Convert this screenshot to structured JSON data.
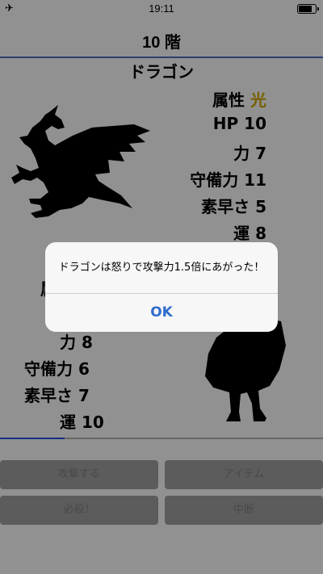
{
  "status": {
    "time": "19:11",
    "airplane_icon": "airplane-icon",
    "battery_level": 0.85
  },
  "header": {
    "floor": "10 階"
  },
  "enemy": {
    "name": "ドラゴン",
    "attribute_label": "属性",
    "attribute_value": "光",
    "attribute_color": "#c9a000",
    "hp": "HP 10",
    "power": "力 7",
    "defense": "守備力 11",
    "speed": "素早さ 5",
    "luck": "運 8",
    "icon": "dragon-icon"
  },
  "player": {
    "partial_label": "属",
    "power": "力 8",
    "defense": "守備力 6",
    "speed": "素早さ 7",
    "luck": "運 10",
    "icon": "hero-icon",
    "hp_fraction": 0.2
  },
  "commands": {
    "attack": "攻撃する",
    "item": "アイテム",
    "special": "必殺！",
    "quit": "中断"
  },
  "alert": {
    "message": "ドラゴンは怒りで攻撃力1.5倍にあがった！",
    "ok": "OK"
  },
  "colors": {
    "accent": "#2f6ccc",
    "rule": "#4a6bb8",
    "hp_bar": "#1f4fd1"
  }
}
